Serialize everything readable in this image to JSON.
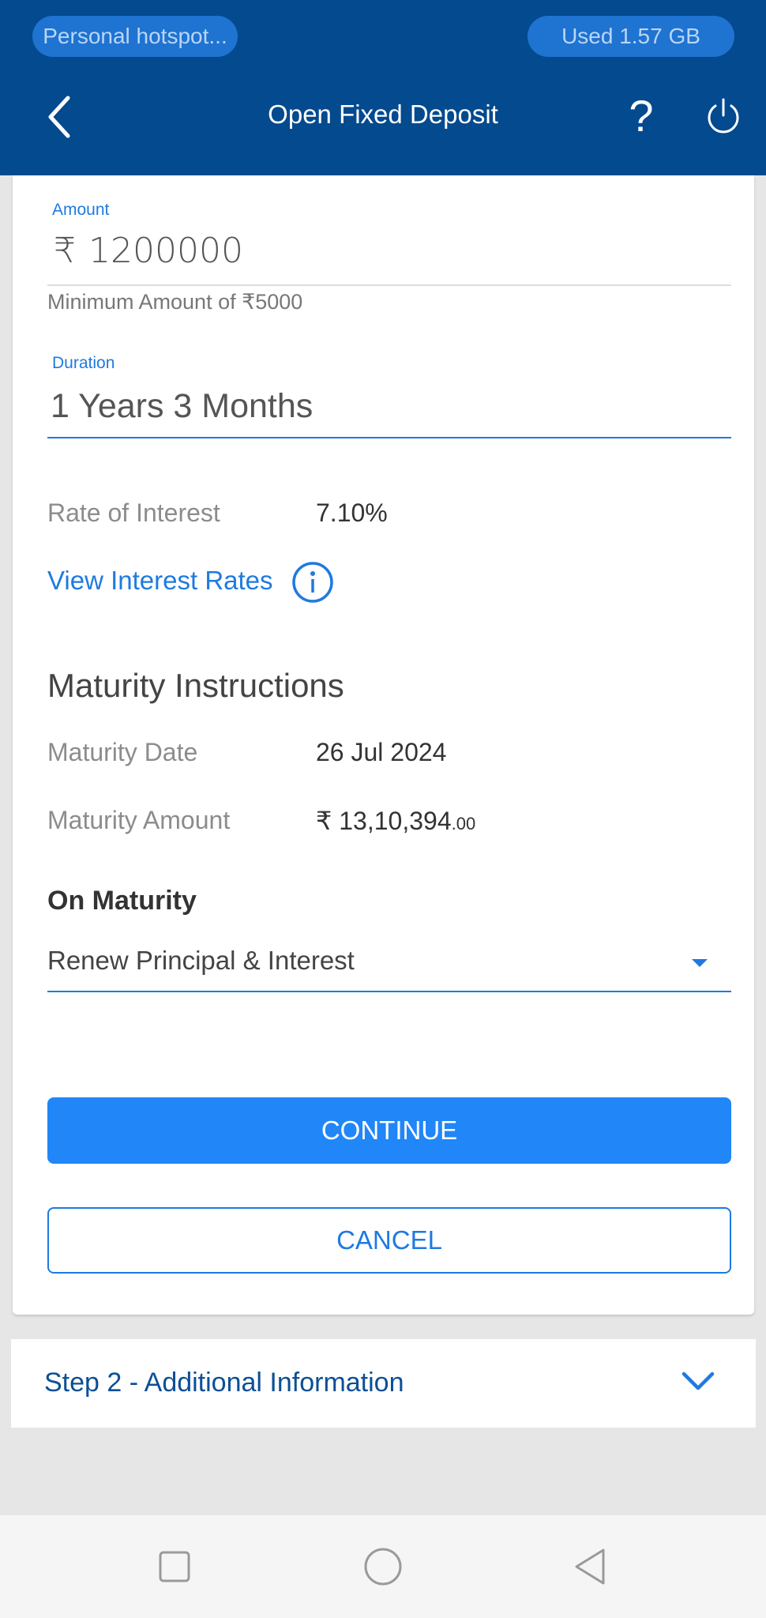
{
  "status": {
    "hotspot": "Personal hotspot...",
    "data_used": "Used  1.57 GB"
  },
  "header": {
    "title": "Open Fixed Deposit",
    "help": "?"
  },
  "form": {
    "amount_label": "Amount",
    "currency_symbol": "₹",
    "amount_value": "1200000",
    "amount_helper": "Minimum Amount of ₹5000",
    "duration_label": "Duration",
    "duration_value": "1 Years 3 Months",
    "rate_label": "Rate of Interest",
    "rate_value": "7.10%",
    "view_rates_link": "View Interest Rates"
  },
  "maturity": {
    "title": "Maturity Instructions",
    "date_label": "Maturity Date",
    "date_value": "26 Jul 2024",
    "amount_label": "Maturity Amount",
    "amount_main": "₹ 13,10,394",
    "amount_paise": ".00",
    "on_maturity_label": "On Maturity",
    "on_maturity_value": "Renew Principal & Interest"
  },
  "actions": {
    "continue": "CONTINUE",
    "cancel": "CANCEL"
  },
  "step2": {
    "label": "Step 2 - Additional Information"
  },
  "colors": {
    "header_bg": "#034a8f",
    "accent": "#1e7ae0",
    "primary_button": "#2186f7"
  },
  "icons": {
    "back": "chevron-left-icon",
    "help": "question-icon",
    "power": "power-icon",
    "info": "info-icon",
    "dropdown": "caret-down-icon",
    "expand": "chevron-down-icon",
    "nav_recents": "square-icon",
    "nav_home": "circle-icon",
    "nav_back": "triangle-back-icon"
  }
}
